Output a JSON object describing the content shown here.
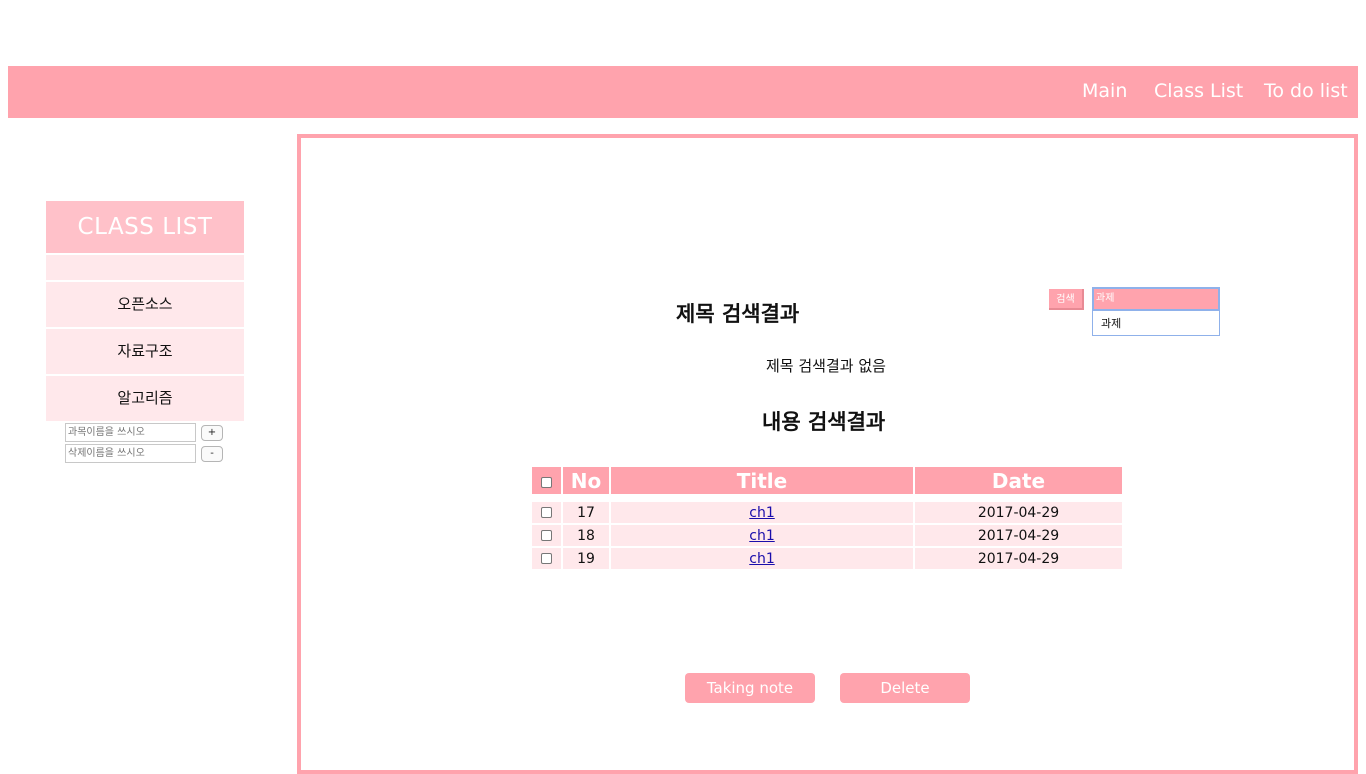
{
  "nav": {
    "items": [
      "Main",
      "Class List",
      "To do list"
    ]
  },
  "sidebar": {
    "title": "CLASS LIST",
    "items": [
      "",
      "오픈소스",
      "자료구조",
      "알고리즘"
    ],
    "add_placeholder": "과목이름을 쓰시오",
    "add_button": "+",
    "delete_placeholder": "삭제이름을 쓰시오",
    "delete_button": "-"
  },
  "search": {
    "button_label": "검색",
    "value": "과제",
    "dropdown_option": "과제"
  },
  "title_results": {
    "heading": "제목 검색결과",
    "empty_message": "제목 검색결과 없음"
  },
  "content_results": {
    "heading": "내용 검색결과",
    "columns": [
      "No",
      "Title",
      "Date"
    ],
    "rows": [
      {
        "no": "17",
        "title": "ch1",
        "date": "2017-04-29"
      },
      {
        "no": "18",
        "title": "ch1",
        "date": "2017-04-29"
      },
      {
        "no": "19",
        "title": "ch1",
        "date": "2017-04-29"
      }
    ]
  },
  "actions": {
    "taking_note": "Taking note",
    "delete": "Delete"
  },
  "colors": {
    "accent": "#ffa3ad",
    "accent_light": "#ffc1c9",
    "row_bg": "#ffe8eb"
  }
}
